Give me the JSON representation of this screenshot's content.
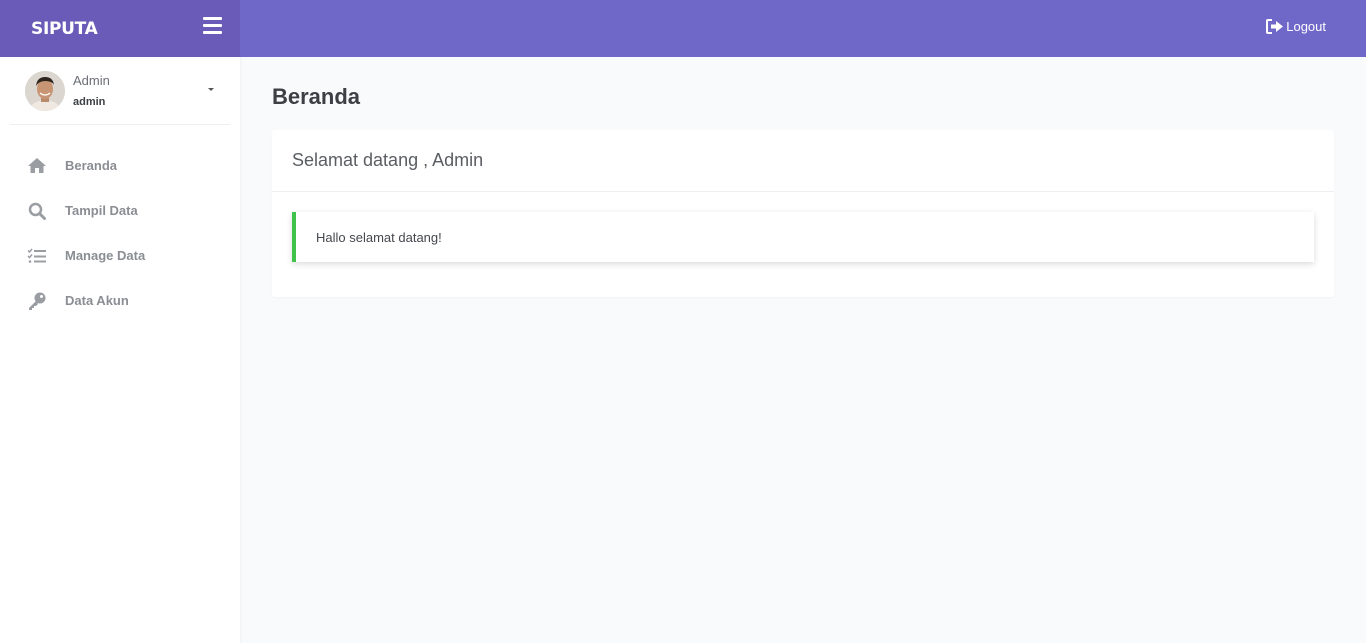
{
  "brand": {
    "name": "SIPUTA"
  },
  "topbar": {
    "logout_label": "Logout"
  },
  "user": {
    "name": "Admin",
    "role": "admin"
  },
  "sidebar": {
    "items": [
      {
        "label": "Beranda",
        "icon": "home-icon"
      },
      {
        "label": "Tampil Data",
        "icon": "search-icon"
      },
      {
        "label": "Manage Data",
        "icon": "checklist-icon"
      },
      {
        "label": "Data Akun",
        "icon": "key-icon"
      }
    ]
  },
  "main": {
    "title": "Beranda",
    "card_title": "Selamat datang , Admin",
    "alert_text": "Hallo selamat datang!"
  },
  "colors": {
    "brand_bg": "#6a5bb9",
    "topbar_bg": "#7068c9",
    "alert_accent": "#3ec24a"
  }
}
